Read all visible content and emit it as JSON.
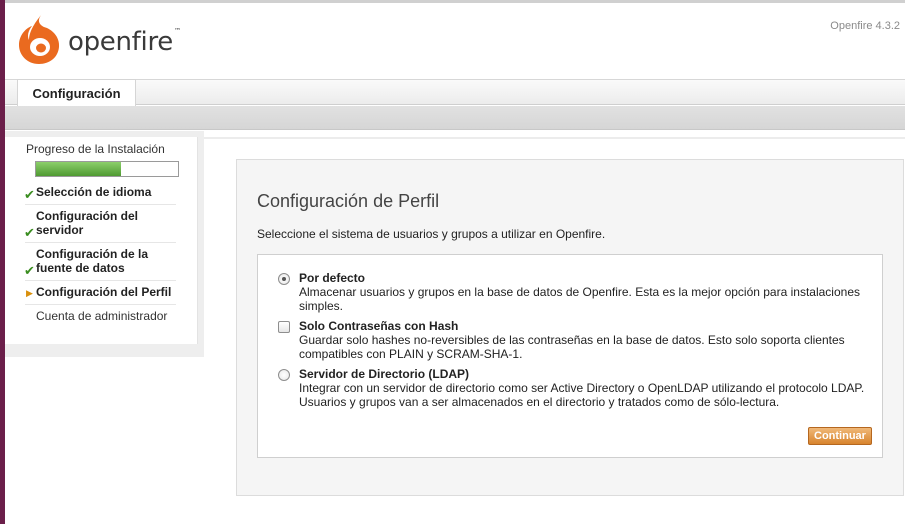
{
  "header": {
    "app_name": "openfire",
    "trademark": "™",
    "version": "Openfire 4.3.2"
  },
  "tabs": [
    {
      "label": "Configuración",
      "active": true
    }
  ],
  "sidebar": {
    "progress_title": "Progreso de la Instalación",
    "progress_fraction": 0.6,
    "steps": [
      {
        "label": "Selección de idioma",
        "status": "done"
      },
      {
        "label": "Configuración del servidor",
        "status": "done"
      },
      {
        "label": "Configuración de la fuente de datos",
        "status": "done"
      },
      {
        "label": "Configuración del Perfil",
        "status": "current"
      },
      {
        "label": "Cuenta de administrador",
        "status": "pending"
      }
    ]
  },
  "main": {
    "title": "Configuración de Perfil",
    "intro": "Seleccione el sistema de usuarios y grupos a utilizar en Openfire.",
    "options": [
      {
        "control": "radio",
        "checked": true,
        "title": "Por defecto",
        "description": "Almacenar usuarios y grupos en la base de datos de Openfire. Esta es la mejor opción para instalaciones simples."
      },
      {
        "control": "checkbox",
        "checked": false,
        "title": "Solo Contraseñas con Hash",
        "description": "Guardar solo hashes no-reversibles de las contraseñas en la base de datos. Esto solo soporta clientes compatibles con PLAIN y SCRAM-SHA-1."
      },
      {
        "control": "radio",
        "checked": false,
        "title": "Servidor de Directorio (LDAP)",
        "description": "Integrar con un servidor de directorio como ser Active Directory o OpenLDAP utilizando el protocolo LDAP. Usuarios y grupos van a ser almacenados en el directorio y tratados como de sólo-lectura."
      }
    ],
    "continue_label": "Continuar"
  },
  "colors": {
    "accent": "#d8842e",
    "progress": "#5ea63c",
    "done_check": "#3a8d1f",
    "logo": "#ea6a1f"
  }
}
